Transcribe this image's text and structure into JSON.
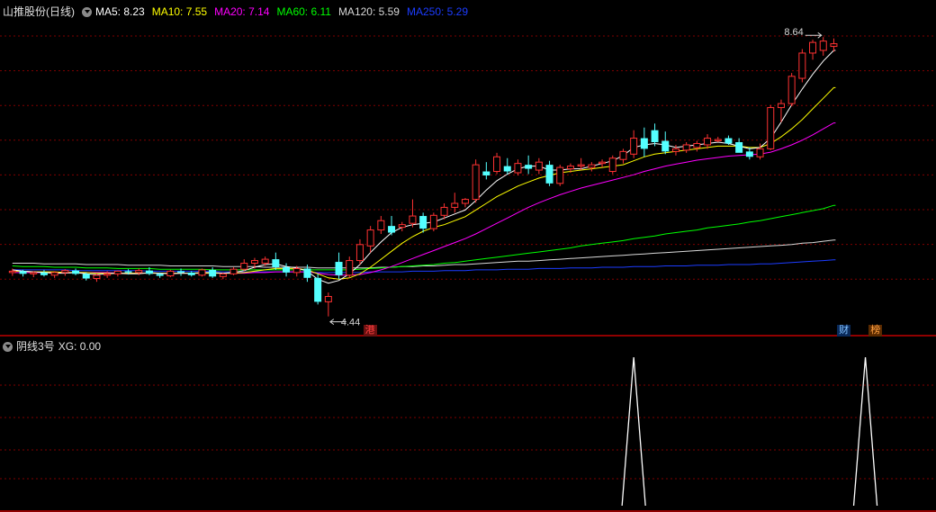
{
  "chart_panel": {
    "title": "山推股份(日线)",
    "ma_legend": [
      {
        "label": "MA5: 8.23",
        "color": "#ffffff"
      },
      {
        "label": "MA10: 7.55",
        "color": "#ffff00"
      },
      {
        "label": "MA20: 7.14",
        "color": "#ff00ff"
      },
      {
        "label": "MA60: 6.11",
        "color": "#00ff00"
      },
      {
        "label": "MA120: 5.59",
        "color": "#d8d8d8"
      },
      {
        "label": "MA250: 5.29",
        "color": "#1c3cff"
      }
    ],
    "high_label": "8.64",
    "low_label": "4.44",
    "markers": [
      {
        "text": "港",
        "color": "#ff4040",
        "bg": "#6a1010"
      },
      {
        "text": "财",
        "color": "#80c0ff",
        "bg": "#0a2a5a"
      },
      {
        "text": "榜",
        "color": "#ffa040",
        "bg": "#5a2a00"
      }
    ]
  },
  "indicator_panel": {
    "title": "阴线3号",
    "xg_label": "XG: 0.00"
  },
  "colors": {
    "up": "#ff3232",
    "down": "#54ffff",
    "grid": "#800000",
    "ma5": "#ffffff",
    "ma10": "#ffff00",
    "ma20": "#ff00ff",
    "ma60": "#00ff00",
    "ma120": "#d8d8d8",
    "ma250": "#1c3cff"
  },
  "chart_data": {
    "type": "candlestick",
    "price_range": [
      4.3,
      8.9
    ],
    "candles": [
      [
        5.1,
        5.16,
        5.05,
        5.12
      ],
      [
        5.12,
        5.14,
        5.04,
        5.08
      ],
      [
        5.08,
        5.12,
        5.03,
        5.1
      ],
      [
        5.1,
        5.14,
        5.04,
        5.06
      ],
      [
        5.06,
        5.12,
        5.02,
        5.1
      ],
      [
        5.1,
        5.15,
        5.05,
        5.13
      ],
      [
        5.13,
        5.16,
        5.06,
        5.08
      ],
      [
        5.08,
        5.1,
        4.98,
        5.01
      ],
      [
        5.01,
        5.08,
        4.96,
        5.06
      ],
      [
        5.06,
        5.12,
        5.02,
        5.08
      ],
      [
        5.08,
        5.13,
        5.04,
        5.12
      ],
      [
        5.12,
        5.15,
        5.07,
        5.1
      ],
      [
        5.1,
        5.16,
        5.06,
        5.13
      ],
      [
        5.13,
        5.18,
        5.06,
        5.08
      ],
      [
        5.08,
        5.1,
        5.02,
        5.05
      ],
      [
        5.05,
        5.14,
        5.03,
        5.12
      ],
      [
        5.12,
        5.16,
        5.05,
        5.1
      ],
      [
        5.1,
        5.12,
        5.04,
        5.06
      ],
      [
        5.06,
        5.16,
        5.04,
        5.14
      ],
      [
        5.14,
        5.18,
        5.02,
        5.04
      ],
      [
        5.04,
        5.1,
        5.0,
        5.08
      ],
      [
        5.08,
        5.18,
        5.06,
        5.15
      ],
      [
        5.15,
        5.3,
        5.12,
        5.24
      ],
      [
        5.24,
        5.32,
        5.16,
        5.28
      ],
      [
        5.24,
        5.34,
        5.2,
        5.3
      ],
      [
        5.3,
        5.4,
        5.14,
        5.18
      ],
      [
        5.18,
        5.24,
        5.04,
        5.1
      ],
      [
        5.1,
        5.2,
        5.04,
        5.16
      ],
      [
        5.16,
        5.22,
        4.96,
        5.02
      ],
      [
        5.02,
        5.08,
        4.62,
        4.66
      ],
      [
        4.66,
        4.8,
        4.44,
        4.74
      ],
      [
        5.26,
        5.4,
        5.0,
        5.06
      ],
      [
        5.06,
        5.34,
        5.02,
        5.28
      ],
      [
        5.28,
        5.6,
        5.22,
        5.52
      ],
      [
        5.5,
        5.8,
        5.4,
        5.74
      ],
      [
        5.74,
        5.95,
        5.68,
        5.88
      ],
      [
        5.8,
        5.95,
        5.66,
        5.7
      ],
      [
        5.78,
        5.86,
        5.72,
        5.82
      ],
      [
        5.84,
        6.2,
        5.78,
        5.95
      ],
      [
        5.95,
        6.0,
        5.7,
        5.76
      ],
      [
        5.76,
        6.0,
        5.72,
        5.96
      ],
      [
        5.96,
        6.14,
        5.9,
        6.08
      ],
      [
        6.08,
        6.3,
        6.0,
        6.14
      ],
      [
        6.14,
        6.22,
        6.08,
        6.2
      ],
      [
        6.2,
        6.8,
        6.15,
        6.72
      ],
      [
        6.62,
        6.76,
        6.5,
        6.56
      ],
      [
        6.62,
        6.9,
        6.58,
        6.84
      ],
      [
        6.7,
        6.82,
        6.58,
        6.62
      ],
      [
        6.6,
        6.8,
        6.56,
        6.74
      ],
      [
        6.72,
        6.86,
        6.58,
        6.66
      ],
      [
        6.64,
        6.82,
        6.58,
        6.76
      ],
      [
        6.72,
        6.78,
        6.4,
        6.44
      ],
      [
        6.44,
        6.72,
        6.4,
        6.68
      ],
      [
        6.66,
        6.74,
        6.6,
        6.7
      ],
      [
        6.7,
        6.82,
        6.64,
        6.72
      ],
      [
        6.68,
        6.76,
        6.62,
        6.72
      ],
      [
        6.74,
        6.8,
        6.68,
        6.76
      ],
      [
        6.62,
        6.86,
        6.58,
        6.82
      ],
      [
        6.8,
        6.96,
        6.74,
        6.92
      ],
      [
        6.88,
        7.24,
        6.82,
        7.12
      ],
      [
        7.12,
        7.28,
        6.84,
        6.96
      ],
      [
        7.24,
        7.34,
        7.0,
        7.06
      ],
      [
        7.08,
        7.22,
        6.88,
        6.92
      ],
      [
        6.92,
        7.02,
        6.86,
        6.96
      ],
      [
        6.94,
        7.06,
        6.9,
        7.02
      ],
      [
        6.98,
        7.08,
        6.92,
        7.04
      ],
      [
        7.02,
        7.18,
        6.96,
        7.12
      ],
      [
        7.08,
        7.14,
        7.06,
        7.1
      ],
      [
        7.12,
        7.16,
        7.02,
        7.04
      ],
      [
        7.06,
        7.12,
        6.96,
        6.9
      ],
      [
        6.92,
        6.98,
        6.8,
        6.84
      ],
      [
        6.84,
        7.04,
        6.8,
        6.96
      ],
      [
        6.96,
        7.62,
        6.94,
        7.58
      ],
      [
        7.58,
        7.7,
        7.36,
        7.64
      ],
      [
        7.64,
        8.1,
        7.6,
        8.05
      ],
      [
        8.02,
        8.46,
        7.96,
        8.4
      ],
      [
        8.4,
        8.6,
        8.3,
        8.56
      ],
      [
        8.44,
        8.64,
        8.36,
        8.58
      ],
      [
        8.5,
        8.62,
        8.42,
        8.54
      ]
    ],
    "ma_series": {
      "ma5": [
        5.14,
        5.12,
        5.11,
        5.1,
        5.09,
        5.09,
        5.1,
        5.08,
        5.07,
        5.08,
        5.09,
        5.08,
        5.08,
        5.1,
        5.09,
        5.08,
        5.09,
        5.09,
        5.1,
        5.1,
        5.09,
        5.1,
        5.13,
        5.18,
        5.22,
        5.23,
        5.19,
        5.17,
        5.12,
        5.0,
        4.94,
        4.98,
        5.08,
        5.22,
        5.4,
        5.56,
        5.7,
        5.78,
        5.82,
        5.84,
        5.86,
        5.92,
        5.98,
        6.04,
        6.18,
        6.34,
        6.48,
        6.58,
        6.66,
        6.7,
        6.7,
        6.64,
        6.64,
        6.66,
        6.66,
        6.7,
        6.74,
        6.78,
        6.86,
        6.98,
        7.02,
        7.04,
        7.02,
        6.98,
        7.0,
        7.02,
        7.04,
        7.06,
        7.04,
        7.0,
        6.96,
        6.98,
        7.12,
        7.36,
        7.62,
        7.86,
        8.08,
        8.28,
        8.44
      ],
      "ma10": [
        5.12,
        5.12,
        5.11,
        5.11,
        5.11,
        5.1,
        5.1,
        5.1,
        5.09,
        5.09,
        5.09,
        5.09,
        5.09,
        5.09,
        5.09,
        5.09,
        5.09,
        5.09,
        5.09,
        5.09,
        5.09,
        5.09,
        5.1,
        5.12,
        5.14,
        5.16,
        5.16,
        5.16,
        5.14,
        5.08,
        5.02,
        5.0,
        5.02,
        5.08,
        5.18,
        5.3,
        5.42,
        5.54,
        5.64,
        5.72,
        5.78,
        5.82,
        5.88,
        5.94,
        6.04,
        6.14,
        6.24,
        6.32,
        6.4,
        6.46,
        6.52,
        6.56,
        6.6,
        6.62,
        6.64,
        6.66,
        6.68,
        6.7,
        6.72,
        6.78,
        6.84,
        6.88,
        6.9,
        6.92,
        6.94,
        6.96,
        6.98,
        7.0,
        7.0,
        7.0,
        6.98,
        6.98,
        7.04,
        7.14,
        7.26,
        7.4,
        7.56,
        7.72,
        7.88
      ],
      "ma20": [
        5.1,
        5.1,
        5.1,
        5.1,
        5.1,
        5.1,
        5.1,
        5.1,
        5.1,
        5.1,
        5.09,
        5.09,
        5.09,
        5.09,
        5.09,
        5.09,
        5.09,
        5.09,
        5.09,
        5.09,
        5.09,
        5.09,
        5.09,
        5.1,
        5.1,
        5.11,
        5.11,
        5.11,
        5.11,
        5.09,
        5.07,
        5.06,
        5.06,
        5.07,
        5.1,
        5.14,
        5.19,
        5.25,
        5.31,
        5.37,
        5.43,
        5.49,
        5.55,
        5.61,
        5.68,
        5.76,
        5.84,
        5.92,
        6.0,
        6.08,
        6.15,
        6.21,
        6.27,
        6.32,
        6.37,
        6.41,
        6.45,
        6.49,
        6.53,
        6.57,
        6.62,
        6.66,
        6.7,
        6.73,
        6.76,
        6.79,
        6.81,
        6.83,
        6.85,
        6.86,
        6.87,
        6.88,
        6.91,
        6.96,
        7.02,
        7.09,
        7.17,
        7.26,
        7.35
      ],
      "ma60": [
        5.2,
        5.19,
        5.19,
        5.19,
        5.18,
        5.18,
        5.18,
        5.17,
        5.17,
        5.17,
        5.16,
        5.16,
        5.16,
        5.16,
        5.15,
        5.15,
        5.15,
        5.15,
        5.15,
        5.14,
        5.14,
        5.14,
        5.14,
        5.14,
        5.14,
        5.14,
        5.14,
        5.14,
        5.14,
        5.14,
        5.14,
        5.14,
        5.14,
        5.15,
        5.16,
        5.17,
        5.18,
        5.19,
        5.2,
        5.21,
        5.22,
        5.24,
        5.25,
        5.27,
        5.29,
        5.31,
        5.33,
        5.35,
        5.37,
        5.39,
        5.41,
        5.43,
        5.45,
        5.47,
        5.5,
        5.52,
        5.54,
        5.56,
        5.58,
        5.61,
        5.63,
        5.65,
        5.68,
        5.7,
        5.72,
        5.74,
        5.77,
        5.79,
        5.81,
        5.83,
        5.86,
        5.88,
        5.91,
        5.94,
        5.97,
        6.0,
        6.03,
        6.06,
        6.11
      ],
      "ma120": [
        5.24,
        5.24,
        5.24,
        5.23,
        5.23,
        5.23,
        5.23,
        5.22,
        5.22,
        5.22,
        5.22,
        5.21,
        5.21,
        5.21,
        5.21,
        5.2,
        5.2,
        5.2,
        5.2,
        5.2,
        5.19,
        5.19,
        5.19,
        5.19,
        5.18,
        5.18,
        5.18,
        5.18,
        5.18,
        5.17,
        5.17,
        5.17,
        5.17,
        5.17,
        5.17,
        5.18,
        5.18,
        5.19,
        5.19,
        5.2,
        5.2,
        5.21,
        5.22,
        5.22,
        5.23,
        5.24,
        5.25,
        5.26,
        5.27,
        5.27,
        5.28,
        5.29,
        5.3,
        5.31,
        5.32,
        5.33,
        5.34,
        5.35,
        5.36,
        5.37,
        5.38,
        5.39,
        5.4,
        5.41,
        5.42,
        5.43,
        5.44,
        5.45,
        5.46,
        5.47,
        5.48,
        5.49,
        5.5,
        5.51,
        5.52,
        5.54,
        5.55,
        5.57,
        5.59
      ],
      "ma250": [
        5.14,
        5.14,
        5.14,
        5.14,
        5.14,
        5.14,
        5.13,
        5.13,
        5.13,
        5.13,
        5.13,
        5.13,
        5.13,
        5.12,
        5.12,
        5.12,
        5.12,
        5.12,
        5.12,
        5.12,
        5.11,
        5.11,
        5.11,
        5.11,
        5.11,
        5.11,
        5.11,
        5.11,
        5.11,
        5.1,
        5.1,
        5.1,
        5.1,
        5.1,
        5.11,
        5.11,
        5.11,
        5.11,
        5.12,
        5.12,
        5.12,
        5.13,
        5.13,
        5.13,
        5.14,
        5.14,
        5.14,
        5.15,
        5.15,
        5.15,
        5.16,
        5.16,
        5.16,
        5.17,
        5.17,
        5.17,
        5.18,
        5.18,
        5.18,
        5.19,
        5.19,
        5.19,
        5.2,
        5.2,
        5.2,
        5.21,
        5.21,
        5.21,
        5.22,
        5.22,
        5.22,
        5.23,
        5.23,
        5.24,
        5.25,
        5.26,
        5.27,
        5.28,
        5.29
      ]
    },
    "signal_index": [
      59,
      81
    ],
    "high_index": 77,
    "low_index": 30,
    "markers_index": [
      34,
      79,
      82
    ]
  }
}
